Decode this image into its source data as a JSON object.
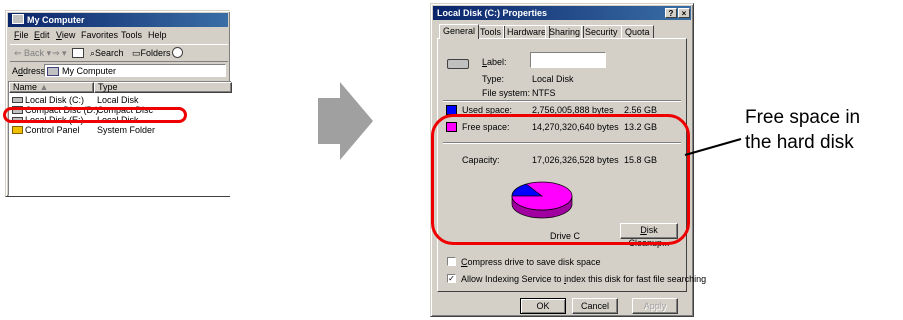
{
  "explorer": {
    "title": "My Computer",
    "menu": [
      "File",
      "Edit",
      "View",
      "Favorites",
      "Tools",
      "Help"
    ],
    "toolbar": {
      "back": "Back",
      "search": "Search",
      "folders": "Folders"
    },
    "address_label": "Address",
    "address_value": "My Computer",
    "columns": [
      "Name",
      "Type"
    ],
    "rows": [
      {
        "name": "Local Disk (C:)",
        "type": "Local Disk",
        "icon": "hard-drive-icon"
      },
      {
        "name": "Compact Disc (D:)",
        "type": "Compact Disc",
        "icon": "cd-drive-icon"
      },
      {
        "name": "Local Disk (E:)",
        "type": "Local Disk",
        "icon": "hard-drive-icon"
      },
      {
        "name": "Control Panel",
        "type": "System Folder",
        "icon": "control-panel-icon"
      }
    ]
  },
  "props": {
    "title": "Local Disk (C:) Properties",
    "title_buttons": [
      "?",
      "×"
    ],
    "tabs": [
      "General",
      "Tools",
      "Hardware",
      "Sharing",
      "Security",
      "Quota"
    ],
    "label_caption": "Label:",
    "label_value": "",
    "type_caption": "Type:",
    "type_value": "Local Disk",
    "fs_caption": "File system:",
    "fs_value": "NTFS",
    "used_caption": "Used space:",
    "used_bytes": "2,756,005,888 bytes",
    "used_gb": "2.56 GB",
    "free_caption": "Free space:",
    "free_bytes": "14,270,320,640 bytes",
    "free_gb": "13.2 GB",
    "capacity_caption": "Capacity:",
    "capacity_bytes": "17,026,326,528 bytes",
    "capacity_gb": "15.8 GB",
    "drive_caption": "Drive C",
    "cleanup_button": "Disk Cleanup...",
    "compress_label": "Compress drive to save disk space",
    "compress_checked": false,
    "index_label": "Allow Indexing Service to index this disk for fast file searching",
    "index_checked": true,
    "ok": "OK",
    "cancel": "Cancel",
    "apply": "Apply",
    "colors": {
      "used": "#0000ff",
      "free": "#ff00ff"
    },
    "used_fraction": 0.162
  },
  "annotation": {
    "line1": "Free space in",
    "line2": "the hard disk",
    "highlight_color": "#ee0000"
  }
}
